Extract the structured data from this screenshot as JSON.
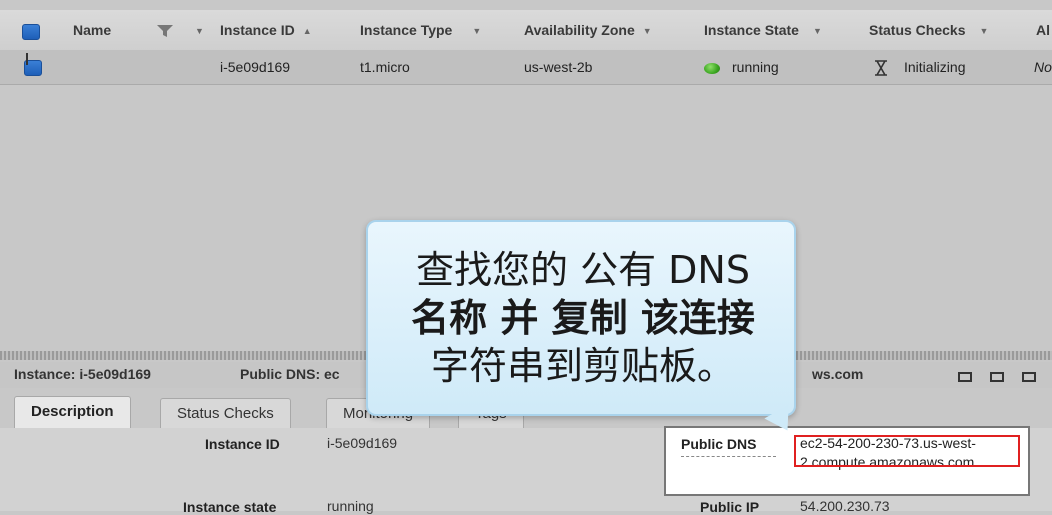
{
  "table": {
    "columns": [
      {
        "key": "name",
        "label": "Name"
      },
      {
        "key": "instance_id",
        "label": "Instance ID"
      },
      {
        "key": "instance_type",
        "label": "Instance Type"
      },
      {
        "key": "availability_zone",
        "label": "Availability Zone"
      },
      {
        "key": "instance_state",
        "label": "Instance State"
      },
      {
        "key": "status_checks",
        "label": "Status Checks"
      },
      {
        "key": "alarm",
        "label": "Al"
      }
    ],
    "row": {
      "instance_id": "i-5e09d169",
      "instance_type": "t1.micro",
      "availability_zone": "us-west-2b",
      "instance_state": "running",
      "status_checks": "Initializing",
      "alarm": "No"
    }
  },
  "details_header": {
    "instance": "Instance: i-5e09d169",
    "public_dns": "Public DNS: ec",
    "suffix": "ws.com"
  },
  "tabs": [
    "Description",
    "Status Checks",
    "Monitoring",
    "Tags"
  ],
  "description": {
    "instance_id_label": "Instance ID",
    "instance_id_value": "i-5e09d169",
    "instance_state_label": "Instance state",
    "instance_state_value": "running",
    "public_dns_label": "Public DNS",
    "public_dns_value": "ec2-54-200-230-73.us-west-2.compute.amazonaws.com",
    "public_ip_label": "Public IP",
    "public_ip_value": "54.200.230.73"
  },
  "callout": {
    "line1": "查找您的 公有 DNS",
    "line2": "名称 并 复制 该连接",
    "line3": "字符串到剪贴板。"
  },
  "colors": {
    "highlight": "#e02020",
    "running": "#3aa520",
    "selected": "#1e5fb8"
  }
}
